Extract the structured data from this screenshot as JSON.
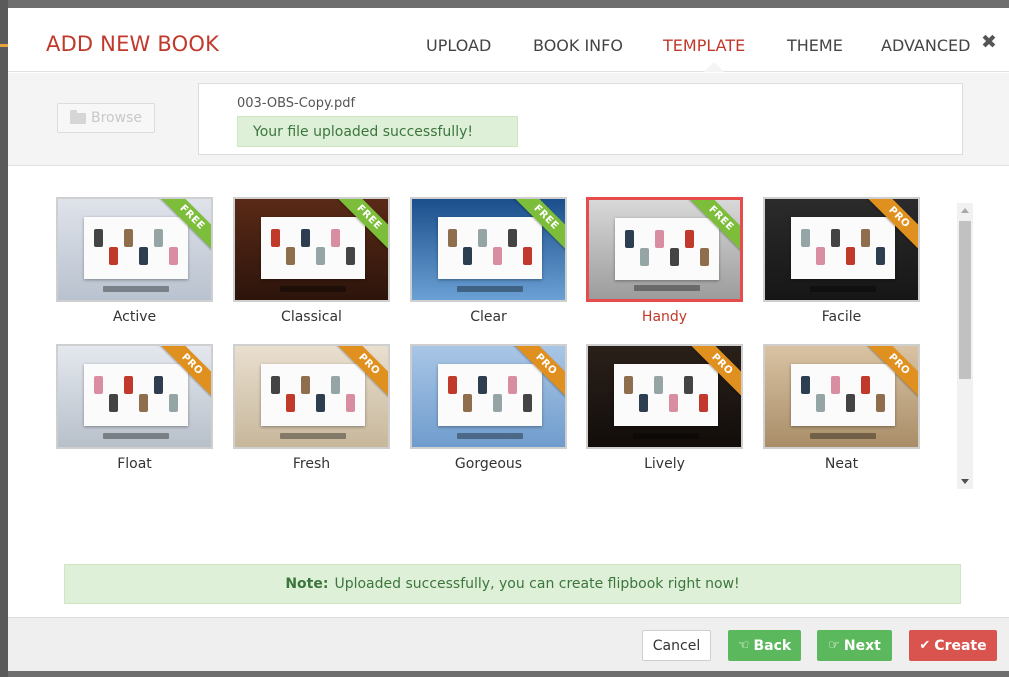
{
  "header": {
    "title": "ADD NEW BOOK",
    "tabs": [
      {
        "label": "UPLOAD",
        "active": false
      },
      {
        "label": "BOOK INFO",
        "active": false
      },
      {
        "label": "TEMPLATE",
        "active": true
      },
      {
        "label": "THEME",
        "active": false
      },
      {
        "label": "ADVANCED",
        "active": false
      }
    ],
    "close_icon": "close-icon"
  },
  "upload": {
    "browse_label": "Browse",
    "browse_icon": "folder-open-icon",
    "file_name": "003-OBS-Copy.pdf",
    "success_message": "Your file uploaded successfully!"
  },
  "templates": [
    {
      "name": "Active",
      "badge": "FREE",
      "selected": false
    },
    {
      "name": "Classical",
      "badge": "FREE",
      "selected": false
    },
    {
      "name": "Clear",
      "badge": "FREE",
      "selected": false
    },
    {
      "name": "Handy",
      "badge": "FREE",
      "selected": true
    },
    {
      "name": "Facile",
      "badge": "PRO",
      "selected": false
    },
    {
      "name": "Float",
      "badge": "PRO",
      "selected": false
    },
    {
      "name": "Fresh",
      "badge": "PRO",
      "selected": false
    },
    {
      "name": "Gorgeous",
      "badge": "PRO",
      "selected": false
    },
    {
      "name": "Lively",
      "badge": "PRO",
      "selected": false
    },
    {
      "name": "Neat",
      "badge": "PRO",
      "selected": false
    }
  ],
  "note": {
    "label": "Note:",
    "text": "Uploaded successfully, you can create flipbook right now!"
  },
  "footer": {
    "cancel_label": "Cancel",
    "back_label": "Back",
    "next_label": "Next",
    "create_label": "Create"
  },
  "colors": {
    "accent_red": "#c0392b",
    "free_badge": "#7cbd3a",
    "pro_badge": "#e0901f",
    "success_bg": "#dff0d8",
    "success_text": "#3c763d",
    "create_button": "#d9534f",
    "nav_button": "#5cb85c"
  }
}
